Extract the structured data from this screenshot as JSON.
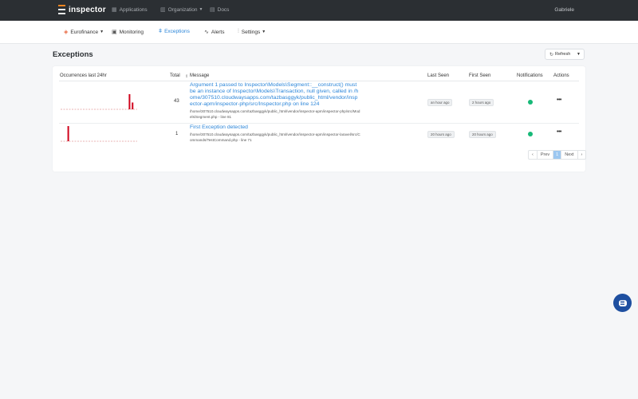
{
  "topbar": {
    "brand": "inspector",
    "nav": [
      {
        "label": "Applications",
        "icon": "grid-icon"
      },
      {
        "label": "Organization",
        "icon": "building-icon"
      },
      {
        "label": "Docs",
        "icon": "book-icon"
      }
    ],
    "user": "Gabriele"
  },
  "subnav": {
    "items": [
      {
        "label": "Eurofinance",
        "icon": "app-icon"
      },
      {
        "label": "Monitoring",
        "icon": "monitor-icon"
      },
      {
        "label": "Exceptions",
        "icon": "bug-icon",
        "active": true
      },
      {
        "label": "Alerts",
        "icon": "pulse-icon"
      },
      {
        "label": "Settings",
        "icon": "sliders-icon"
      }
    ]
  },
  "page": {
    "title": "Exceptions",
    "refresh_label": "Refresh"
  },
  "table": {
    "columns": [
      "Occurrences last 24hr",
      "Total",
      "Message",
      "Last Seen",
      "First Seen",
      "Notifications",
      "Actions"
    ],
    "rows": [
      {
        "total": "43",
        "message": "Argument 1 passed to Inspector\\Models\\Segment::__construct() must be an instance of Inspector\\Models\\Transaction, null given, called in /home/307510.cloudwaysapps.com/tazbasggyk/public_html/vendor/inspector-apm/inspector-php/src/Inspector.php on line 124",
        "path": "/home/307510.cloudwaysapps.com/tazbasggyk/public_html/vendor/inspector-apm/inspector-php/src/Models/Segment.php - line 81",
        "last_seen": "an hour ago",
        "first_seen": "2 hours ago",
        "notifications": true,
        "spark": [
          0,
          0,
          0,
          0,
          0,
          0,
          0,
          0,
          0,
          0,
          0,
          0,
          0,
          0,
          0,
          0,
          0,
          0,
          0,
          0,
          0,
          0,
          1.0,
          0.45,
          0
        ]
      },
      {
        "total": "1",
        "message": "First Exception detected",
        "path": "/home/307510.cloudwaysapps.com/tazbasggyk/public_html/vendor/inspector-apm/inspector-laravel/src/Commands/TestCommand.php - line 71",
        "last_seen": "20 hours ago",
        "first_seen": "20 hours ago",
        "notifications": true,
        "spark": [
          0,
          0,
          1.0,
          0,
          0,
          0,
          0,
          0,
          0,
          0,
          0,
          0,
          0,
          0,
          0,
          0,
          0,
          0,
          0,
          0,
          0,
          0,
          0,
          0,
          0
        ]
      }
    ]
  },
  "pagination": {
    "prev": "Prev",
    "current": "1",
    "next": "Next"
  },
  "colors": {
    "accent": "#2c86d9",
    "spark_bar": "#d0021b",
    "notification_on": "#17b978",
    "topbar_bg": "#2b2f33"
  }
}
